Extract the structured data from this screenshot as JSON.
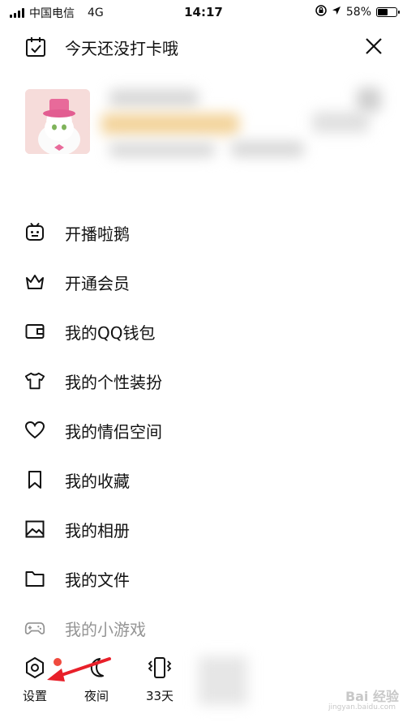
{
  "status_bar": {
    "carrier": "中国电信",
    "network": "4G",
    "time": "14:17",
    "battery": "58%",
    "battery_level": 0.58
  },
  "header": {
    "checkin_text": "今天还没打卡哦"
  },
  "menu": {
    "items": [
      {
        "label": "开播啦鹅",
        "icon": "live-broadcast-icon"
      },
      {
        "label": "开通会员",
        "icon": "crown-icon"
      },
      {
        "label": "我的QQ钱包",
        "icon": "wallet-icon"
      },
      {
        "label": "我的个性装扮",
        "icon": "tshirt-icon"
      },
      {
        "label": "我的情侣空间",
        "icon": "heart-icon"
      },
      {
        "label": "我的收藏",
        "icon": "bookmark-icon"
      },
      {
        "label": "我的相册",
        "icon": "photo-album-icon"
      },
      {
        "label": "我的文件",
        "icon": "folder-icon"
      },
      {
        "label": "我的小游戏",
        "icon": "gamepad-icon"
      }
    ]
  },
  "bottom_bar": {
    "settings_label": "设置",
    "night_label": "夜间",
    "days_label": "33天"
  },
  "watermark": {
    "brand": "Bai 经验",
    "url": "jingyan.baidu.com"
  },
  "colors": {
    "accent_dot": "#f04a3e",
    "arrow": "#e8202a"
  }
}
